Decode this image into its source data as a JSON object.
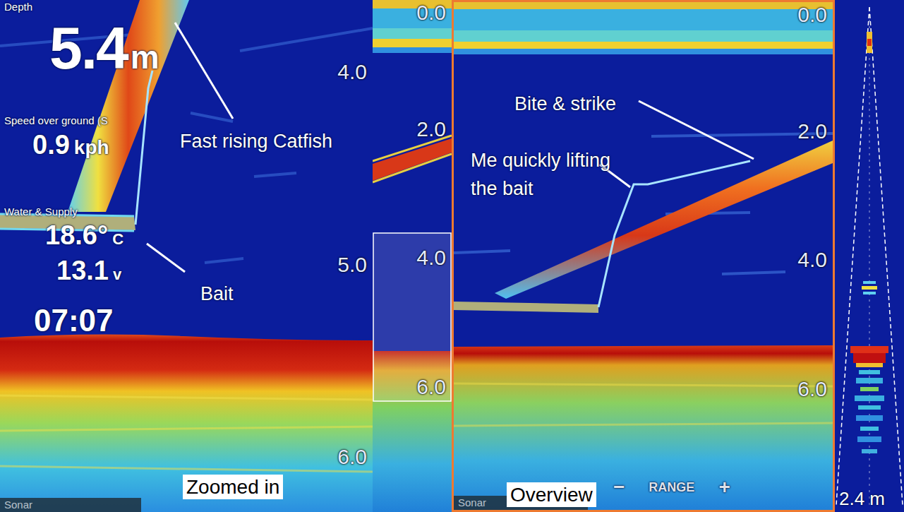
{
  "zoomed_panel": {
    "readouts": {
      "depth_label": "Depth",
      "depth_value": "5.4",
      "depth_unit": "m",
      "speed_label": "Speed over ground (S",
      "speed_value": "0.9",
      "speed_unit": "kph",
      "water_label": "Water & Supply",
      "temperature_value": "18.6°",
      "temperature_unit": "C",
      "voltage_value": "13.1",
      "voltage_unit": "v",
      "time": "07:07"
    },
    "scale": [
      "4.0",
      "5.0",
      "6.0"
    ],
    "annotations": [
      "Fast rising Catfish",
      "Bait"
    ],
    "caption": "Zoomed in",
    "source_label": "Sonar"
  },
  "overview_strip": {
    "scale": [
      "0.0",
      "2.0",
      "4.0",
      "6.0"
    ]
  },
  "overview_panel": {
    "scale": [
      "0.0",
      "2.0",
      "4.0",
      "6.0"
    ],
    "annotations": [
      "Bite & strike",
      "Me quickly lifting the bait"
    ],
    "caption": "Overview",
    "source_label": "Sonar",
    "range_controls": {
      "minus": "−",
      "label": "RANGE",
      "plus": "+"
    }
  },
  "beam_panel": {
    "range": "2.4 m"
  }
}
